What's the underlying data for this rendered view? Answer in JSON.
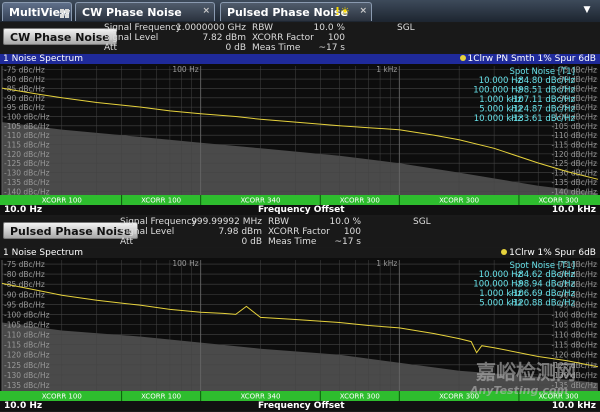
{
  "tabs": [
    {
      "label": "MultiView"
    },
    {
      "label": "CW Phase Noise",
      "close": "×"
    },
    {
      "label": "Pulsed Phase Noise",
      "close": "×",
      "flag": "!☀"
    }
  ],
  "dropdown": "▼",
  "panes": [
    {
      "mode_button": "CW Phase Noise",
      "params_left": [
        {
          "label": "Signal Frequency",
          "value": "1.0000000 GHz"
        },
        {
          "label": "Signal Level",
          "value": "7.82 dBm"
        },
        {
          "label": "Att",
          "value": "0 dB"
        }
      ],
      "params_right": [
        {
          "label": "RBW",
          "value": "10.0 %"
        },
        {
          "label": "XCORR Factor",
          "value": "100"
        },
        {
          "label": "Meas Time",
          "value": "~17 s"
        }
      ],
      "sweep_mode": "SGL",
      "window_title": "1 Noise Spectrum",
      "trace_info": "1Clrw PN Smth 1% Spur 6dB",
      "spot_title": "Spot Noise [T1]",
      "spot": [
        {
          "f": "10.000 Hz",
          "v": "-84.80 dBc/Hz"
        },
        {
          "f": "100.000 Hz",
          "v": "-98.51 dBc/Hz"
        },
        {
          "f": "1.000 kHz",
          "v": "-107.11 dBc/Hz"
        },
        {
          "f": "5.000 kHz",
          "v": "-124.87 dBc/Hz"
        },
        {
          "f": "10.000 kHz",
          "v": "-133.61 dBc/Hz"
        }
      ],
      "y_ticks": [
        "-75 dBc/Hz",
        "-80 dBc/Hz",
        "-85 dBc/Hz",
        "-90 dBc/Hz",
        "-95 dBc/Hz",
        "-100 dBc/Hz",
        "-105 dBc/Hz",
        "-110 dBc/Hz",
        "-115 dBc/Hz",
        "-120 dBc/Hz",
        "-125 dBc/Hz",
        "-130 dBc/Hz",
        "-135 dBc/Hz",
        "-140 dBc/Hz"
      ],
      "decade_labels": [
        "100 Hz",
        "1 kHz"
      ],
      "xcorr_labels": [
        "XCORR 100",
        "XCORR 100",
        "XCORR 340",
        "XCORR 300",
        "XCORR 300",
        "XCORR 300"
      ],
      "x_start": "10.0 Hz",
      "x_center": "Frequency Offset",
      "x_stop": "10.0 kHz"
    },
    {
      "mode_button": "Pulsed Phase Noise",
      "params_left": [
        {
          "label": "Signal Frequency",
          "value": "999.99992 MHz"
        },
        {
          "label": "Signal Level",
          "value": "7.98 dBm"
        },
        {
          "label": "Att",
          "value": "0 dB"
        }
      ],
      "params_right": [
        {
          "label": "RBW",
          "value": "10.0 %"
        },
        {
          "label": "XCORR Factor",
          "value": "100"
        },
        {
          "label": "Meas Time",
          "value": "~17 s"
        }
      ],
      "sweep_mode": "SGL",
      "window_title": "1 Noise Spectrum",
      "trace_info": "1Clrw 1% Spur 6dB",
      "spot_title": "Spot Noise [T1]",
      "spot": [
        {
          "f": "10.000 Hz",
          "v": "-84.62 dBc/Hz"
        },
        {
          "f": "100.000 Hz",
          "v": "-98.94 dBc/Hz"
        },
        {
          "f": "1.000 kHz",
          "v": "-106.69 dBc/Hz"
        },
        {
          "f": "5.000 kHz",
          "v": "-120.88 dBc/Hz"
        }
      ],
      "y_ticks": [
        "-75 dBc/Hz",
        "-80 dBc/Hz",
        "-85 dBc/Hz",
        "-90 dBc/Hz",
        "-95 dBc/Hz",
        "-100 dBc/Hz",
        "-105 dBc/Hz",
        "-110 dBc/Hz",
        "-115 dBc/Hz",
        "-120 dBc/Hz",
        "-125 dBc/Hz",
        "-130 dBc/Hz",
        "-135 dBc/Hz"
      ],
      "decade_labels": [
        "100 Hz",
        "1 kHz"
      ],
      "xcorr_labels": [
        "XCORR 100",
        "XCORR 100",
        "XCORR 340",
        "XCORR 300",
        "XCORR 300",
        "XCORR 300"
      ],
      "x_start": "10.0 Hz",
      "x_center": "Frequency Offset",
      "x_stop": "10.0 kHz"
    }
  ],
  "watermark": {
    "text": "嘉峪检测网",
    "url": "AnyTesting.com"
  },
  "colors": {
    "trace": "#e6d23c",
    "spot": "#66e0e8",
    "grid": "#444444",
    "floor": "#4a4a4a",
    "xcorr_bar": "#2ebd2e",
    "title_bar": "#1f2a9a"
  },
  "chart_data": [
    {
      "type": "line",
      "title": "1 Noise Spectrum",
      "xlabel": "Frequency Offset",
      "x_scale": "log",
      "xlim": [
        10,
        10000
      ],
      "ylim": [
        -142,
        -73
      ],
      "series": [
        {
          "x": [
            10,
            15,
            20,
            30,
            50,
            70,
            100,
            150,
            200,
            300,
            500,
            700,
            1000,
            1500,
            2000,
            3000,
            5000,
            7000,
            10000
          ],
          "y": [
            -84.8,
            -88,
            -90,
            -92.5,
            -95,
            -97,
            -98.5,
            -100,
            -101.5,
            -103,
            -105,
            -106,
            -107.1,
            -110,
            -112.5,
            -117,
            -124.9,
            -129.5,
            -133.6
          ]
        }
      ],
      "floor": {
        "x": [
          10,
          20,
          50,
          100,
          200,
          500,
          1000,
          2000,
          5000,
          10000
        ],
        "y": [
          -103,
          -107,
          -111,
          -114,
          -117,
          -121,
          -125,
          -130,
          -137,
          -141
        ]
      }
    },
    {
      "type": "line",
      "title": "1 Noise Spectrum",
      "xlabel": "Frequency Offset",
      "x_scale": "log",
      "xlim": [
        10,
        10000
      ],
      "ylim": [
        -138,
        -73
      ],
      "series": [
        {
          "x": [
            10,
            15,
            20,
            30,
            50,
            70,
            100,
            130,
            150,
            170,
            200,
            300,
            500,
            700,
            1000,
            1500,
            2000,
            2300,
            2450,
            2600,
            3000,
            5000,
            7000,
            10000
          ],
          "y": [
            -84.6,
            -88,
            -90.5,
            -93,
            -95.5,
            -97.5,
            -98.9,
            -99.5,
            -100,
            -96,
            -101.5,
            -102.5,
            -104,
            -105.5,
            -106.7,
            -109.5,
            -112,
            -113.5,
            -119,
            -115.5,
            -116.5,
            -120.9,
            -123,
            -126
          ]
        }
      ],
      "floor": {
        "x": [
          10,
          20,
          50,
          100,
          200,
          500,
          1000,
          2000,
          5000,
          10000
        ],
        "y": [
          -104,
          -108,
          -111,
          -114,
          -117,
          -120,
          -124,
          -128,
          -131,
          -134
        ]
      }
    }
  ]
}
